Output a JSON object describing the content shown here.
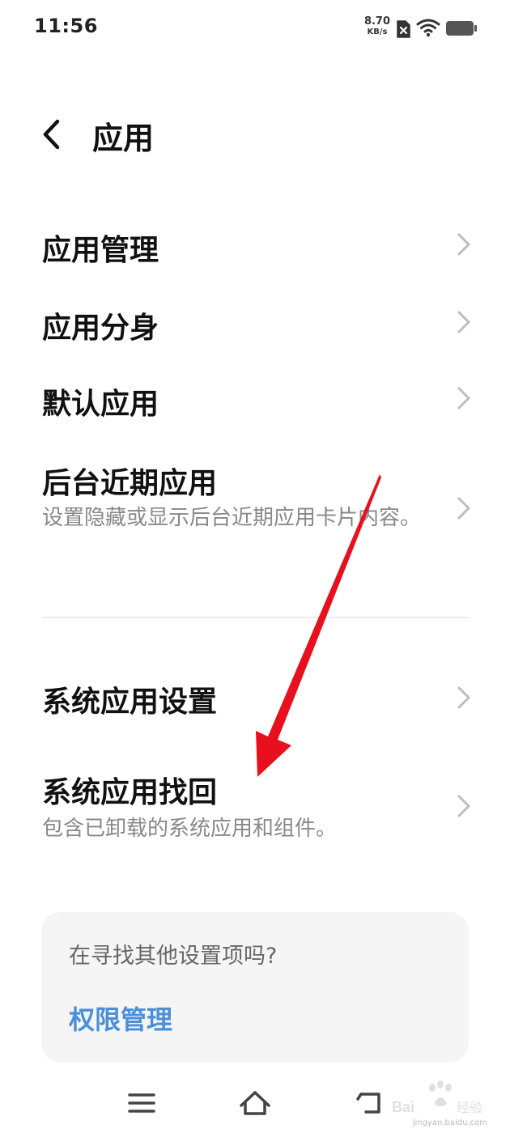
{
  "status_bar": {
    "time": "11:56",
    "net_speed_value": "8.70",
    "net_speed_unit": "KB/s",
    "icons": [
      "sim-error-icon",
      "wifi-icon",
      "battery-icon"
    ]
  },
  "header": {
    "back_icon": "chevron-left-icon",
    "title": "应用"
  },
  "items": [
    {
      "title": "应用管理"
    },
    {
      "title": "应用分身"
    },
    {
      "title": "默认应用"
    },
    {
      "title": "后台近期应用",
      "subtitle": "设置隐藏或显示后台近期应用卡片内容。"
    },
    {
      "title": "系统应用设置"
    },
    {
      "title": "系统应用找回",
      "subtitle": "包含已卸载的系统应用和组件。"
    }
  ],
  "suggestion_card": {
    "prompt": "在寻找其他设置项吗?",
    "link": "权限管理"
  },
  "nav_bar": {
    "icons": [
      "menu-icon",
      "home-icon",
      "back-icon"
    ]
  },
  "watermark": {
    "logo": "Bai 经验",
    "url": "jingyan.baidu.com"
  },
  "colors": {
    "link": "#4a8fd8",
    "annotation_arrow": "#e8101e",
    "card_background": "#f5f5f5",
    "subtitle_text": "#888888"
  }
}
